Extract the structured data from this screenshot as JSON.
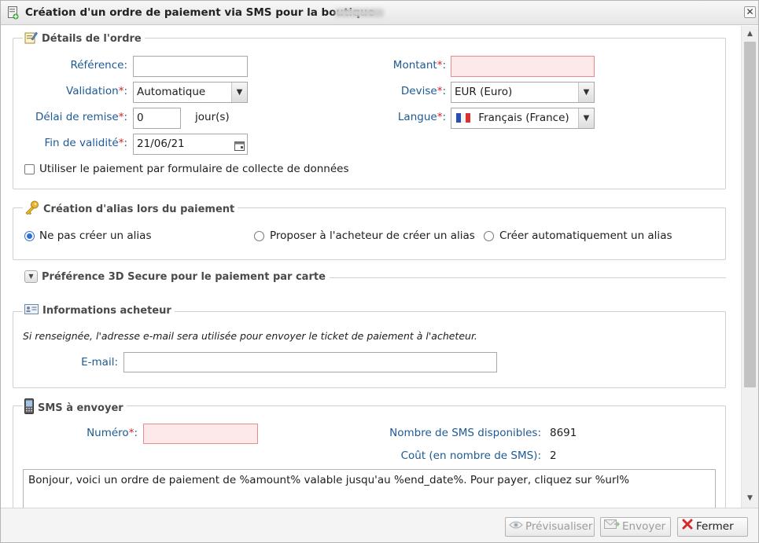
{
  "window": {
    "title": "Création d'un ordre de paiement via SMS pour la boutique"
  },
  "order": {
    "legend": "Détails de l'ordre",
    "reference_label": "Référence:",
    "reference_value": "",
    "validation_label": "Validation",
    "validation_value": "Automatique",
    "delay_label": "Délai de remise",
    "delay_value": "0",
    "delay_unit": "jour(s)",
    "expiry_label": "Fin de validité",
    "expiry_value": "21/06/21",
    "amount_label": "Montant",
    "amount_value": "",
    "currency_label": "Devise",
    "currency_value": "EUR (Euro)",
    "language_label": "Langue",
    "language_value": "Français (France)",
    "form_checkbox_label": "Utiliser le paiement par formulaire de collecte de données",
    "required_mark": "*",
    "colon": ":"
  },
  "alias": {
    "legend": "Création d'alias lors du paiement",
    "options": [
      "Ne pas créer un alias",
      "Proposer à l'acheteur de créer un alias",
      "Créer automatiquement un alias"
    ],
    "selected_index": 0
  },
  "secure3d": {
    "legend": "Préférence 3D Secure pour le paiement par carte"
  },
  "buyer": {
    "legend": "Informations acheteur",
    "note": "Si renseignée, l'adresse e-mail sera utilisée pour envoyer le ticket de paiement à l'acheteur.",
    "email_label": "E-mail:",
    "email_value": ""
  },
  "sms": {
    "legend": "SMS à envoyer",
    "number_label": "Numéro",
    "number_value": "",
    "available_label": "Nombre de SMS disponibles:",
    "available_value": "8691",
    "cost_label": "Coût (en nombre de SMS):",
    "cost_value": "2",
    "message": "Bonjour, voici un ordre de paiement de %amount% valable jusqu'au %end_date%. Pour payer, cliquez sur %url%"
  },
  "footer": {
    "preview_label": "Prévisualiser",
    "send_label": "Envoyer",
    "close_label": "Fermer"
  },
  "colors": {
    "label_blue": "#1d5a94",
    "required_red": "#d42020",
    "error_bg": "#fde9e9",
    "radio_blue": "#2f6fd6"
  },
  "icons": [
    "document-add-icon",
    "edit-icon",
    "key-icon",
    "expand-icon",
    "id-card-icon",
    "mobile-phone-icon",
    "calendar-icon",
    "flag-france-icon",
    "eye-icon",
    "send-mail-icon",
    "close-x-icon"
  ]
}
